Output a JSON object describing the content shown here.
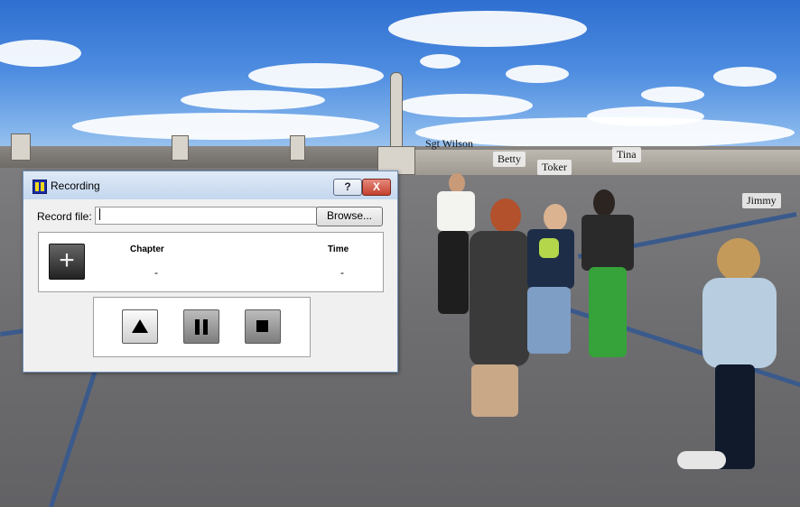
{
  "window": {
    "title": "Recording",
    "help_label": "?",
    "close_label": "X"
  },
  "record": {
    "label": "Record file:",
    "value": "",
    "browse_label": "Browse..."
  },
  "chapters": {
    "add_label": "+",
    "chapter_header": "Chapter",
    "time_header": "Time",
    "chapter_value": "-",
    "time_value": "-"
  },
  "controls": {
    "play_icon": "triangle-up-icon",
    "pause_icon": "pause-icon",
    "stop_icon": "stop-icon"
  },
  "scene": {
    "name_tags": [
      "Sgt Wilson",
      "Betty",
      "Toker",
      "Tina",
      "Jimmy"
    ]
  },
  "colors": {
    "sky": "#4d8ce0",
    "ground": "#6d6d70",
    "window_bg": "#f0f0f0",
    "close_button": "#c4402e",
    "title_bar": "#c4d6ee"
  }
}
